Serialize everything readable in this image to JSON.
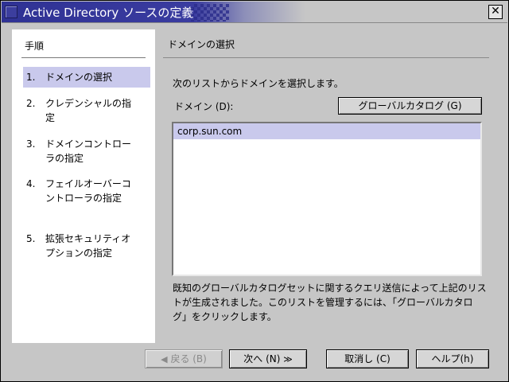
{
  "window": {
    "title": "Active Directory ソースの定義",
    "close_glyph": "✕"
  },
  "steps": {
    "heading": "手順",
    "items": [
      {
        "num": "1.",
        "label": "ドメインの選択",
        "active": true
      },
      {
        "num": "2.",
        "label": "クレデンシャルの指定",
        "active": false
      },
      {
        "num": "3.",
        "label": "ドメインコントローラの指定",
        "active": false
      },
      {
        "num": "4.",
        "label": "フェイルオーバーコントローラの指定",
        "active": false
      },
      {
        "num": "5.",
        "label": "拡張セキュリティオプションの指定",
        "active": false
      }
    ]
  },
  "main": {
    "heading": "ドメインの選択",
    "instruction": "次のリストからドメインを選択します。",
    "domain_label": "ドメイン (D):",
    "global_catalog_button": "グローバルカタログ (G)",
    "domains": [
      "corp.sun.com"
    ],
    "description": "既知のグローバルカタログセットに関するクエリ送信によって上記のリストが生成されました。このリストを管理するには、「グローバルカタログ」をクリックします。"
  },
  "buttons": {
    "back": "戻る (B)",
    "back_arrow": "◀",
    "next": "次へ (N)",
    "next_arrow": "≫",
    "cancel": "取消し (C)",
    "help": "ヘルプ(h)"
  },
  "colors": {
    "titlebar": "#2f3294",
    "selection": "#c9c9ec",
    "window_bg": "#c6c6c6"
  }
}
